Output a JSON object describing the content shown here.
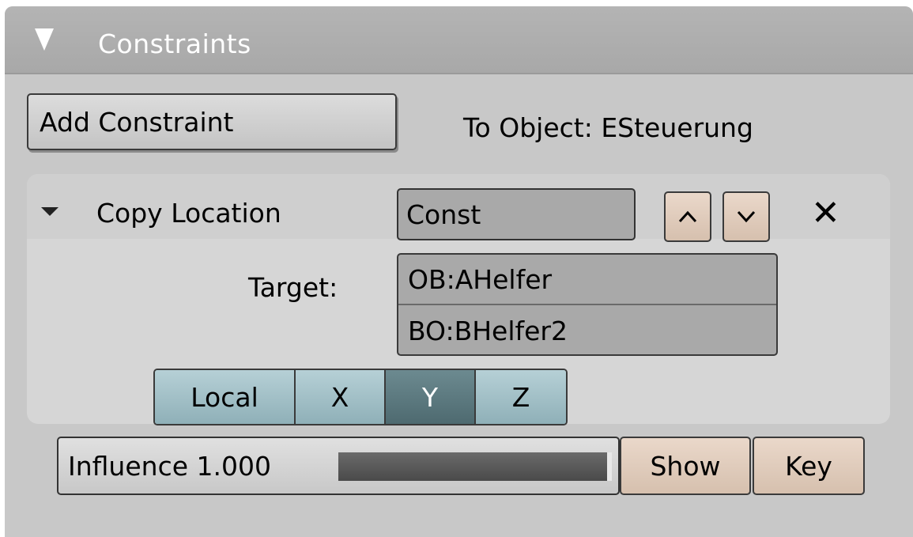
{
  "panel": {
    "title": "Constraints",
    "collapse_icon": "triangle-down-icon"
  },
  "toolbar": {
    "add_constraint_label": "Add Constraint",
    "to_object_text": "To Object: ESteuerung"
  },
  "constraint": {
    "type_label": "Copy Location",
    "name_value": "Const",
    "move_up_icon": "chevron-up-icon",
    "move_down_icon": "chevron-down-icon",
    "delete_icon": "close-icon",
    "target_label": "Target:",
    "target_object": "OB:AHelfer",
    "target_bone": "BO:BHelfer2",
    "axes": [
      {
        "label": "Local",
        "active": false
      },
      {
        "label": "X",
        "active": false
      },
      {
        "label": "Y",
        "active": true
      },
      {
        "label": "Z",
        "active": false
      }
    ]
  },
  "influence": {
    "label": "Influence 1.000",
    "value": 1.0,
    "show_label": "Show",
    "key_label": "Key"
  },
  "colors": {
    "panel_bg": "#c8c8c8",
    "axis_button": "#a8c4cb",
    "axis_active": "#5d7a80",
    "warm_button": "#e0ccbc"
  }
}
